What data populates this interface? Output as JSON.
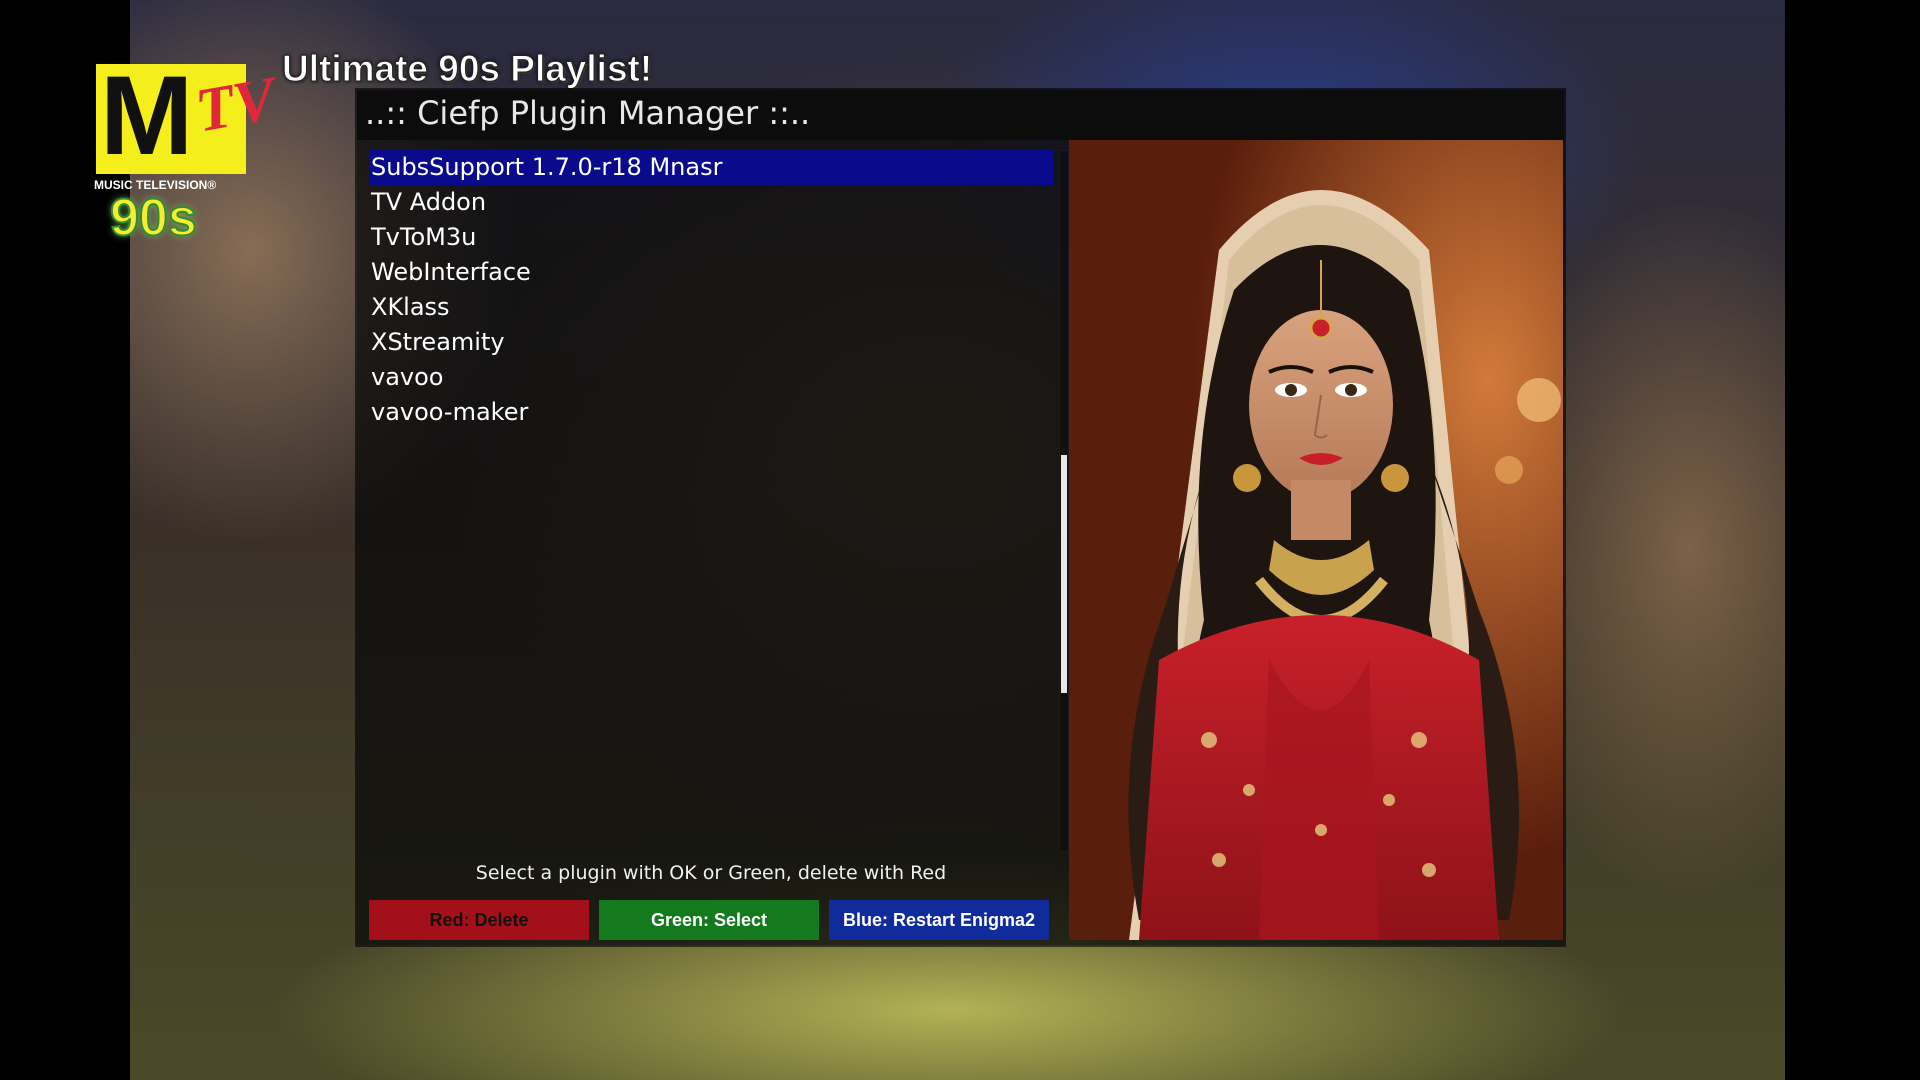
{
  "background": {
    "logo": {
      "mark": "M",
      "tv": "TV",
      "tagline": "MUSIC TELEVISION®",
      "decade": "90s"
    },
    "playlist_title": "Ultimate 90s Playlist!"
  },
  "window": {
    "title": "..:: Ciefp Plugin Manager ::..",
    "plugins": [
      "SubsSupport 1.7.0-r18 Mnasr",
      "TV Addon",
      "TvToM3u",
      "WebInterface",
      "XKlass",
      "XStreamity",
      "vavoo",
      "vavoo-maker"
    ],
    "selected_index": 0,
    "scroll_position_fraction": 0.66,
    "help_text": "Select a plugin with OK or Green, delete with Red",
    "buttons": {
      "red": "Red: Delete",
      "green": "Green: Select",
      "blue": "Blue: Restart Enigma2"
    }
  },
  "colors": {
    "selection": "#0a0a8c",
    "red": "#a3101a",
    "green": "#157a1e",
    "blue": "#0f2c9a",
    "logo_yellow": "#f4ee1c"
  }
}
